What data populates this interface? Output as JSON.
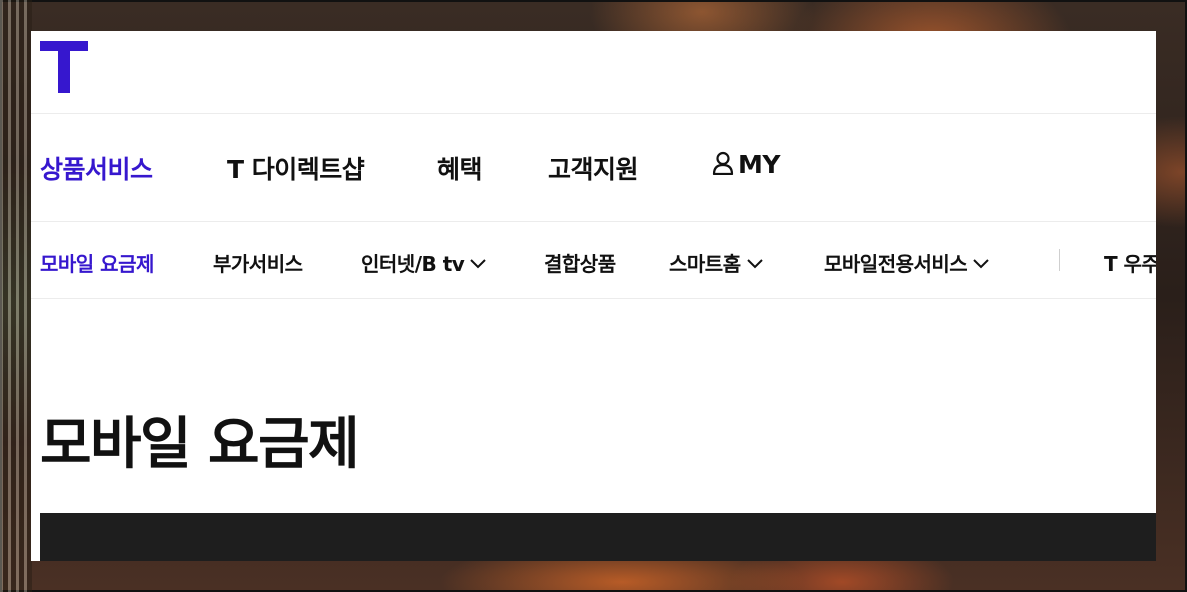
{
  "brand": {
    "logo_letter": "T",
    "accent_color": "#3617ce"
  },
  "gnb": {
    "items": [
      {
        "label": "상품서비스",
        "active": true
      },
      {
        "label": "T 다이렉트샵",
        "active": false
      },
      {
        "label": "혜택",
        "active": false
      },
      {
        "label": "고객지원",
        "active": false
      },
      {
        "label": "MY",
        "icon": "user-icon",
        "active": false
      }
    ]
  },
  "lnb": {
    "items": [
      {
        "label": "모바일 요금제",
        "active": true,
        "dropdown": false
      },
      {
        "label": "부가서비스",
        "active": false,
        "dropdown": false
      },
      {
        "label": "인터넷/B tv",
        "active": false,
        "dropdown": true
      },
      {
        "label": "결합상품",
        "active": false,
        "dropdown": false
      },
      {
        "label": "스마트홈",
        "active": false,
        "dropdown": true
      },
      {
        "label": "모바일전용서비스",
        "active": false,
        "dropdown": true
      },
      {
        "label": "T 우주",
        "active": false,
        "dropdown": false
      }
    ]
  },
  "main": {
    "page_title": "모바일 요금제"
  }
}
